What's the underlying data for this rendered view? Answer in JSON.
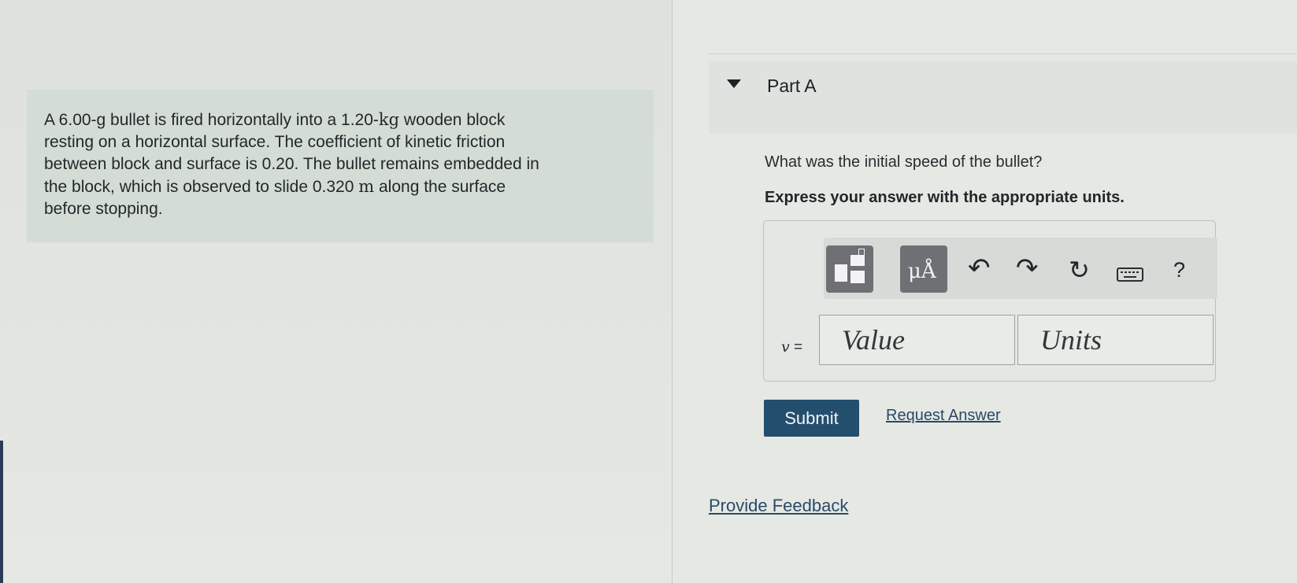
{
  "problem": {
    "line1_pre": "A 6.00-g bullet is fired horizontally into a 1.20-",
    "line1_unit": "kg",
    "line1_post": " wooden block",
    "line2": "resting on a horizontal surface. The coefficient of kinetic friction",
    "line3": "between block and surface is 0.20. The bullet remains embedded in",
    "line4_pre": "the block, which is observed to slide 0.320 ",
    "line4_unit": "m",
    "line4_post": " along the surface",
    "line5": "before stopping."
  },
  "part": {
    "title": "Part A",
    "question": "What was the initial speed of the bullet?",
    "instruction": "Express your answer with the appropriate units."
  },
  "toolbar": {
    "units_button": "μÅ",
    "undo_icon": "↶",
    "redo_icon": "↷",
    "reset_icon": "↻",
    "help_label": "?"
  },
  "answer": {
    "variable": "v",
    "equals": " =",
    "value_placeholder": "Value",
    "units_placeholder": "Units"
  },
  "actions": {
    "submit_label": "Submit",
    "request_answer_label": "Request Answer",
    "provide_feedback_label": "Provide Feedback"
  }
}
